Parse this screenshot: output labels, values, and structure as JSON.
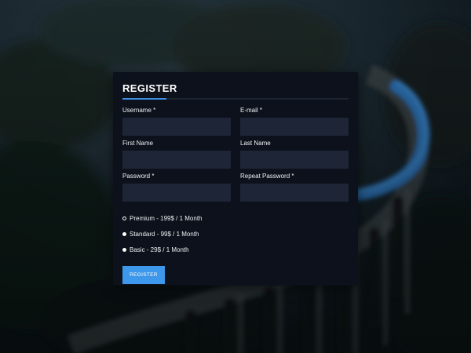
{
  "form": {
    "title": "REGISTER",
    "fields": {
      "username": {
        "label": "Username *",
        "value": ""
      },
      "email": {
        "label": "E-mail *",
        "value": ""
      },
      "first_name": {
        "label": "First Name",
        "value": ""
      },
      "last_name": {
        "label": "Last Name",
        "value": ""
      },
      "password": {
        "label": "Password *",
        "value": ""
      },
      "repeat_password": {
        "label": "Repeat Password *",
        "value": ""
      }
    },
    "plans": [
      {
        "label": "Premium - 199$ / 1 Month",
        "selected": true
      },
      {
        "label": "Standard - 99$ / 1 Month",
        "selected": false
      },
      {
        "label": "Basic - 29$ / 1 Month",
        "selected": false
      }
    ],
    "submit_label": "REGISTER"
  },
  "colors": {
    "accent": "#3d97ea",
    "panel": "#0c111b",
    "input": "#1d2537"
  }
}
